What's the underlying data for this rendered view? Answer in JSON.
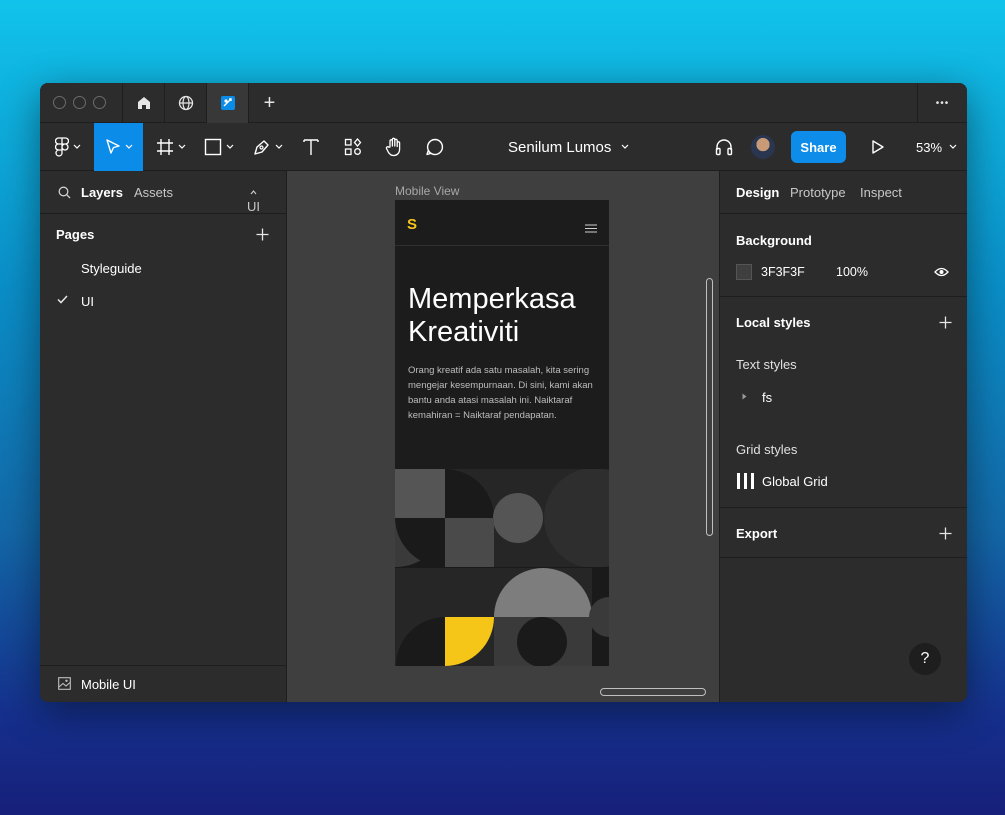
{
  "tabbar": {
    "new_tab_symbol": "+",
    "more_symbol": "•••"
  },
  "toolbar": {
    "file_title": "Senilum Lumos",
    "share_label": "Share",
    "zoom_label": "53%",
    "accent_color": "#0c8ce9"
  },
  "left_panel": {
    "tab_layers": "Layers",
    "tab_assets": "Assets",
    "current_page_short": "UI",
    "pages_header": "Pages",
    "pages": [
      {
        "label": "Styleguide",
        "selected": false
      },
      {
        "label": "UI",
        "selected": true
      }
    ],
    "footer_layer": "Mobile UI"
  },
  "canvas": {
    "frame_label": "Mobile View",
    "phone": {
      "logo": "S",
      "hero_title_line1": "Memperkasa",
      "hero_title_line2": "Kreativiti",
      "hero_body": "Orang kreatif ada satu masalah, kita sering mengejar kesempurnaan. Di sini, kami akan bantu anda atasi masalah ini. Naiktaraf kemahiran = Naiktaraf pendapatan.",
      "accent_yellow": "#f5c518"
    }
  },
  "right_panel": {
    "tab_design": "Design",
    "tab_prototype": "Prototype",
    "tab_inspect": "Inspect",
    "background_title": "Background",
    "background_hex": "3F3F3F",
    "background_opacity": "100%",
    "local_styles_title": "Local styles",
    "text_styles_title": "Text styles",
    "text_style_item": "fs",
    "grid_styles_title": "Grid styles",
    "grid_style_item": "Global Grid",
    "export_title": "Export",
    "help_symbol": "?"
  }
}
